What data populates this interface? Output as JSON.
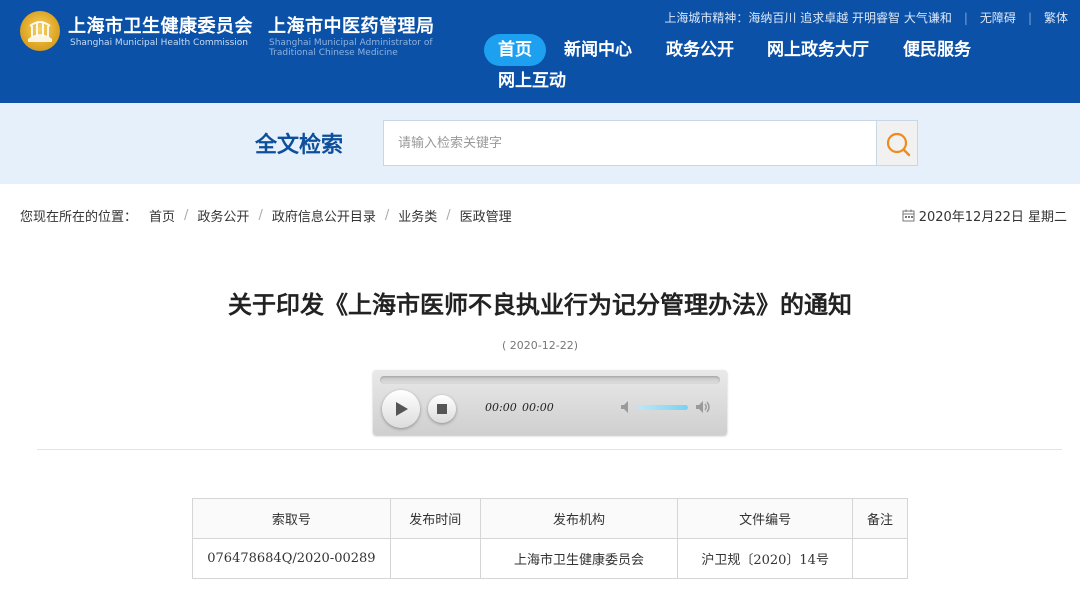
{
  "header": {
    "org1_zh": "上海市卫生健康委员会",
    "org1_en": "Shanghai Municipal Health Commission",
    "org2_zh": "上海市中医药管理局",
    "org2_en_line1": "Shanghai Municipal Administrator of",
    "org2_en_line2": "Traditional Chinese Medicine",
    "slogan": "上海城市精神：海纳百川 追求卓越 开明睿智 大气谦和",
    "accessibility": "无障碍",
    "traditional": "繁体",
    "bg_color": "#0b51a8",
    "active_color": "#1ea0f0"
  },
  "nav": {
    "items": [
      {
        "label": "首页",
        "active": true
      },
      {
        "label": "新闻中心"
      },
      {
        "label": "政务公开"
      },
      {
        "label": "网上政务大厅"
      },
      {
        "label": "便民服务"
      },
      {
        "label": "网上互动"
      }
    ]
  },
  "search": {
    "title": "全文检索",
    "placeholder": "请输入检索关键字",
    "button_icon": "search-icon"
  },
  "breadcrumb": {
    "prefix": "您现在所在的位置：",
    "items": [
      "首页",
      "政务公开",
      "政府信息公开目录",
      "业务类",
      "医政管理"
    ]
  },
  "today": "2020年12月22日 星期二",
  "article": {
    "title": "关于印发《上海市医师不良执业行为记分管理办法》的通知",
    "date": "( 2020-12-22)"
  },
  "player": {
    "current_time": "00:00",
    "total_time": "00:00"
  },
  "info_table": {
    "headers": [
      "索取号",
      "发布时间",
      "发布机构",
      "文件编号",
      "备注"
    ],
    "row": [
      "076478684Q/2020-00289",
      "",
      "上海市卫生健康委员会",
      "沪卫规〔2020〕14号",
      ""
    ]
  }
}
